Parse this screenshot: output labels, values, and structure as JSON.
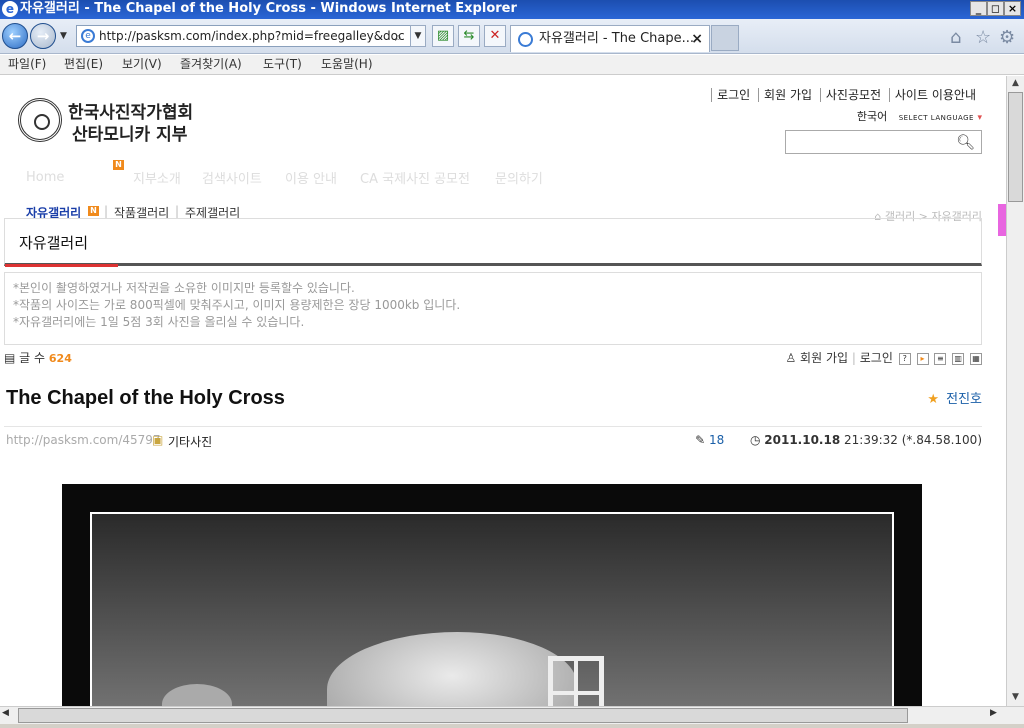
{
  "window": {
    "title": "자유갤러리 - The Chapel of the Holy Cross - Windows Internet Explorer",
    "ie_icon": "e"
  },
  "browser": {
    "address": "http://pasksm.com/index.php?mid=freegalley&doc",
    "tab_title": "자유갤러리 - The Chape..."
  },
  "menu": [
    "파일(F)",
    "편집(E)",
    "보기(V)",
    "즐겨찾기(A)",
    "도구(T)",
    "도움말(H)"
  ],
  "site": {
    "name_line1": "한국사진작가협회",
    "name_line2": "산타모니카 지부",
    "top_links": [
      "로그인",
      "회원 가입",
      "사진공모전",
      "사이트 이용안내"
    ],
    "lang": "한국어",
    "select_language": "SELECT LANGUAGE",
    "gnb": [
      "Home",
      "지부소개",
      "검색사이트",
      "이용 안내",
      "CA 국제사진 공모전",
      "문의하기"
    ],
    "new_badge": "N",
    "lnb": [
      "자유갤러리",
      "작품갤러리",
      "주제갤러리"
    ],
    "breadcrumb": "갤러리 > 자유갤러리"
  },
  "board": {
    "title": "자유갤러리",
    "notice": [
      "*본인이 촬영하였거나 저작권을 소유한 이미지만 등록할수 있습니다.",
      "*작품의 사이즈는 가로 800픽셀에 맞춰주시고, 이미지 용량제한은 장당 1000kb 입니다.",
      "*자유갤러리에는 1일 5점 3회 사진을 올리실 수 있습니다."
    ],
    "count_label": "글 수",
    "count": "624",
    "member_join": "회원 가입",
    "login": "로그인"
  },
  "post": {
    "title": "The Chapel of the Holy Cross",
    "author": "전진호",
    "url": "http://pasksm.com/45797",
    "category": "기타사진",
    "read_count": "18",
    "date": "2011.10.18",
    "time": "21:39:32",
    "ip": "(*.84.58.100)"
  }
}
